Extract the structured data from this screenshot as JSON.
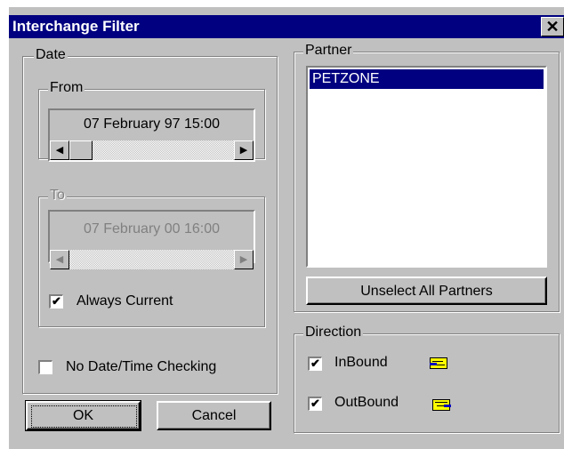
{
  "window": {
    "title": "Interchange Filter",
    "close_glyph": "✕"
  },
  "date_group": {
    "label": "Date",
    "from": {
      "label": "From",
      "value": "07 February 97 15:00"
    },
    "to": {
      "label": "To",
      "value": "07 February 00 16:00",
      "enabled": false
    },
    "always_current": {
      "label": "Always Current",
      "checked": true
    },
    "no_date_check": {
      "label": "No Date/Time Checking",
      "checked": false
    }
  },
  "partner_group": {
    "label": "Partner",
    "items": [
      "PETZONE"
    ],
    "selected_index": 0,
    "unselect_label": "Unselect All Partners"
  },
  "direction_group": {
    "label": "Direction",
    "inbound": {
      "label": "InBound",
      "checked": true,
      "icon": "inbound-envelope-icon"
    },
    "outbound": {
      "label": "OutBound",
      "checked": true,
      "icon": "outbound-envelope-icon"
    }
  },
  "buttons": {
    "ok": "OK",
    "cancel": "Cancel"
  },
  "glyphs": {
    "left": "◀",
    "right": "▶",
    "check": "✔"
  },
  "colors": {
    "titlebar": "#000080",
    "face": "#c0c0c0",
    "selection": "#000080",
    "envelope": "#ffff00"
  }
}
